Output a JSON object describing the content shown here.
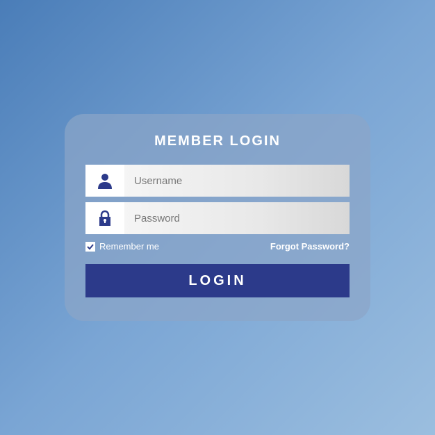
{
  "title": "MEMBER LOGIN",
  "username": {
    "placeholder": "Username",
    "value": ""
  },
  "password": {
    "placeholder": "Password",
    "value": ""
  },
  "remember": {
    "label": "Remember me",
    "checked": true
  },
  "forgot": "Forgot Password?",
  "login_button": "LOGIN",
  "colors": {
    "accent": "#2c3a8a",
    "icon": "#2c3a8a"
  }
}
